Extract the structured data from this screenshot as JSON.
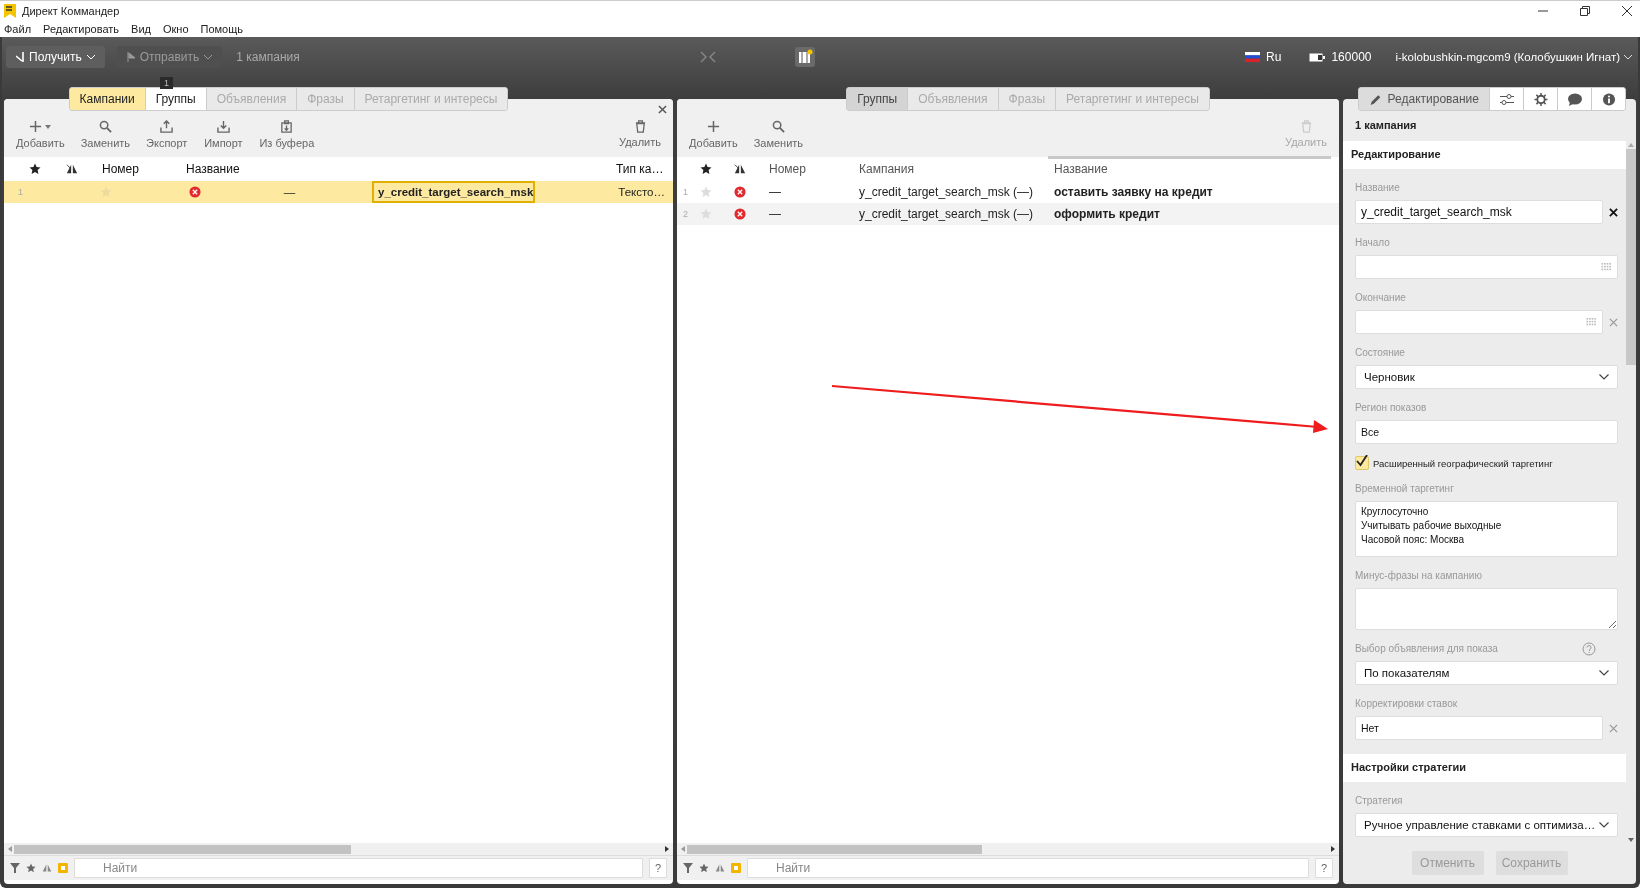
{
  "window": {
    "title": "Директ Коммандер"
  },
  "menu": [
    "Файл",
    "Редактировать",
    "Вид",
    "Окно",
    "Помощь"
  ],
  "toolbar": {
    "get_button": {
      "label": "Получить",
      "disabled": false
    },
    "send_button": {
      "label": "Отправить",
      "disabled": true
    },
    "selection_count": "1 кампания",
    "language": "Ru",
    "balance": "160000",
    "account": "i-kolobushkin-mgcom9 (Колобушкин Игнат)"
  },
  "left_panel": {
    "badge": "1",
    "tabs": [
      {
        "label": "Кампании",
        "selected": true,
        "disabled": false
      },
      {
        "label": "Группы",
        "selected": false,
        "disabled": false
      },
      {
        "label": "Объявления",
        "selected": false,
        "disabled": true
      },
      {
        "label": "Фразы",
        "selected": false,
        "disabled": true
      },
      {
        "label": "Ретаргетинг и интересы",
        "selected": false,
        "disabled": true
      }
    ],
    "actions": [
      {
        "kind": "add",
        "label": "Добавить",
        "disabled": false
      },
      {
        "kind": "replace",
        "label": "Заменить",
        "disabled": false
      },
      {
        "kind": "export",
        "label": "Экспорт",
        "disabled": false
      },
      {
        "kind": "import",
        "label": "Импорт",
        "disabled": false
      },
      {
        "kind": "paste",
        "label": "Из буфера",
        "disabled": false
      }
    ],
    "delete_action": {
      "label": "Удалить",
      "disabled": false
    },
    "columns": [
      "Номер",
      "Название",
      "Тип ка…"
    ],
    "rows": [
      {
        "index": "1",
        "selected": true,
        "starred": false,
        "number": "—",
        "name": "y_credit_target_search_msk",
        "type": "Тексто…"
      }
    ],
    "search": {
      "placeholder": "Найти"
    },
    "help": "?"
  },
  "middle_panel": {
    "tabs": [
      {
        "label": "Группы",
        "selected": true,
        "disabled": false
      },
      {
        "label": "Объявления",
        "selected": false,
        "disabled": true
      },
      {
        "label": "Фразы",
        "selected": false,
        "disabled": true
      },
      {
        "label": "Ретаргетинг и интересы",
        "selected": false,
        "disabled": true
      }
    ],
    "actions": [
      {
        "kind": "add",
        "label": "Добавить",
        "disabled": false
      },
      {
        "kind": "replace",
        "label": "Заменить",
        "disabled": false
      }
    ],
    "delete_action": {
      "label": "Удалить",
      "disabled": true
    },
    "columns": [
      "Номер",
      "Кампания",
      "Название"
    ],
    "rows": [
      {
        "index": "1",
        "selected": false,
        "starred": false,
        "number": "—",
        "campaign": "y_credit_target_search_msk (—)",
        "name": "оставить заявку на кредит"
      },
      {
        "index": "2",
        "selected": false,
        "starred": false,
        "number": "—",
        "campaign": "y_credit_target_search_msk (—)",
        "name": "оформить кредит"
      }
    ],
    "search": {
      "placeholder": "Найти"
    },
    "help": "?"
  },
  "right_panel": {
    "tabs": [
      {
        "kind": "edit",
        "label": "Редактирование",
        "selected": true
      },
      {
        "kind": "sliders",
        "selected": false
      },
      {
        "kind": "settings",
        "selected": false
      },
      {
        "kind": "comments",
        "selected": false
      },
      {
        "kind": "info",
        "selected": false
      }
    ],
    "header": "1 кампания",
    "sections": [
      {
        "title": "Редактирование",
        "fields": [
          {
            "kind": "text",
            "label": "Название",
            "value": "y_credit_target_search_msk",
            "clearable": true,
            "large": true
          },
          {
            "kind": "date",
            "label": "Начало",
            "clearable": false
          },
          {
            "kind": "date",
            "label": "Окончание",
            "clearable": true
          },
          {
            "kind": "select",
            "label": "Состояние",
            "value": "Черновик",
            "help": false
          },
          {
            "kind": "text",
            "label": "Регион показов",
            "value": "Все",
            "clearable": false,
            "large": false
          },
          {
            "kind": "checkbox",
            "label": "Расширенный географический таргетинг",
            "checked": true
          },
          {
            "kind": "multiline",
            "label": "Временной таргетинг",
            "lines": [
              "Круглосуточно",
              "Учитывать рабочие выходные",
              "Часовой пояс: Москва"
            ]
          },
          {
            "kind": "textarea",
            "label": "Минус-фразы на кампанию"
          },
          {
            "kind": "select",
            "label": "Выбор объявления для показа",
            "value": "По показателям",
            "help": true
          },
          {
            "kind": "text",
            "label": "Корректировки ставок",
            "value": "Нет",
            "clearable": true,
            "large": false
          }
        ]
      },
      {
        "title": "Настройки стратегии",
        "fields": [
          {
            "kind": "select",
            "label": "Стратегия",
            "value": "Ручное управление ставками с оптимиза…",
            "help": false
          }
        ]
      }
    ],
    "buttons": [
      {
        "label": "Отменить",
        "disabled": true
      },
      {
        "label": "Сохранить",
        "disabled": true
      }
    ]
  }
}
